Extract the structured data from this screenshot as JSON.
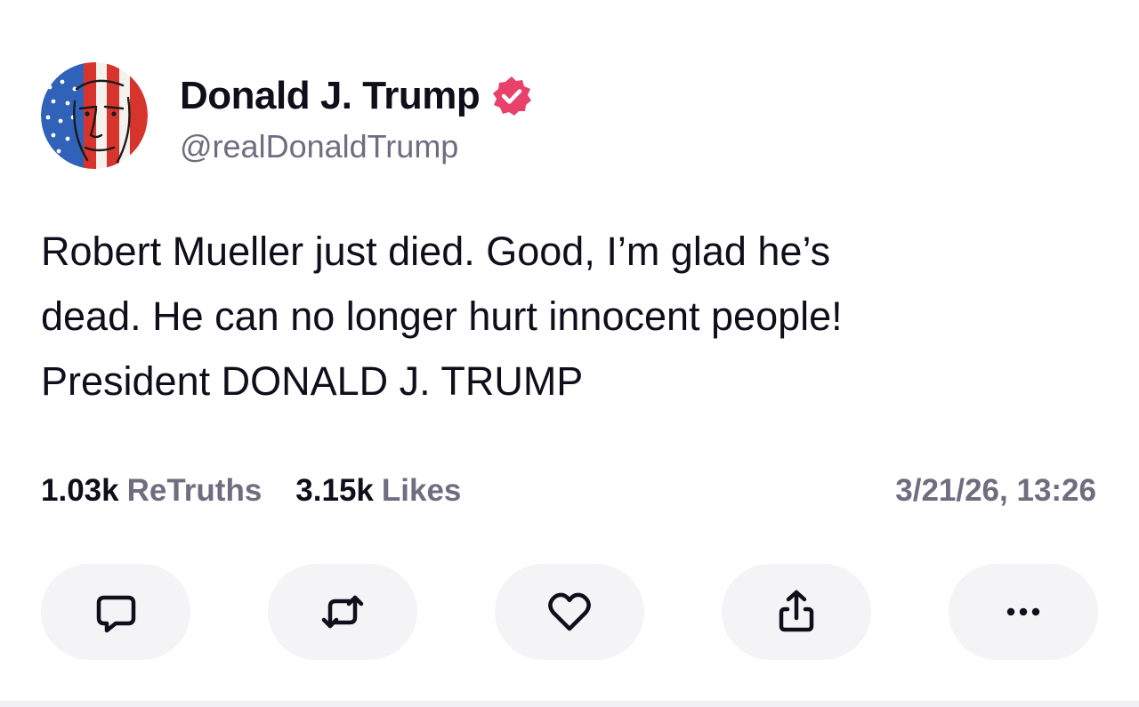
{
  "author": {
    "name": "Donald J. Trump",
    "handle": "@realDonaldTrump",
    "avatar_icon": "flag-portrait-avatar",
    "verified_icon": "verified-badge-icon",
    "verified_color": "#e8416a"
  },
  "post": {
    "lines": [
      "Robert Mueller just died. Good, I’m glad he’s",
      "dead. He can no longer hurt innocent people!",
      "President DONALD J. TRUMP"
    ]
  },
  "stats": {
    "retruths_count": "1.03k",
    "retruths_label": "ReTruths",
    "likes_count": "3.15k",
    "likes_label": "Likes",
    "timestamp": "3/21/26, 13:26"
  },
  "actions": [
    {
      "icon": "reply-icon"
    },
    {
      "icon": "retruth-icon"
    },
    {
      "icon": "heart-icon"
    },
    {
      "icon": "share-icon"
    },
    {
      "icon": "more-icon"
    }
  ],
  "colors": {
    "text": "#0f0e1a",
    "muted": "#6f6d7f",
    "button_bg": "#f4f3f6"
  }
}
